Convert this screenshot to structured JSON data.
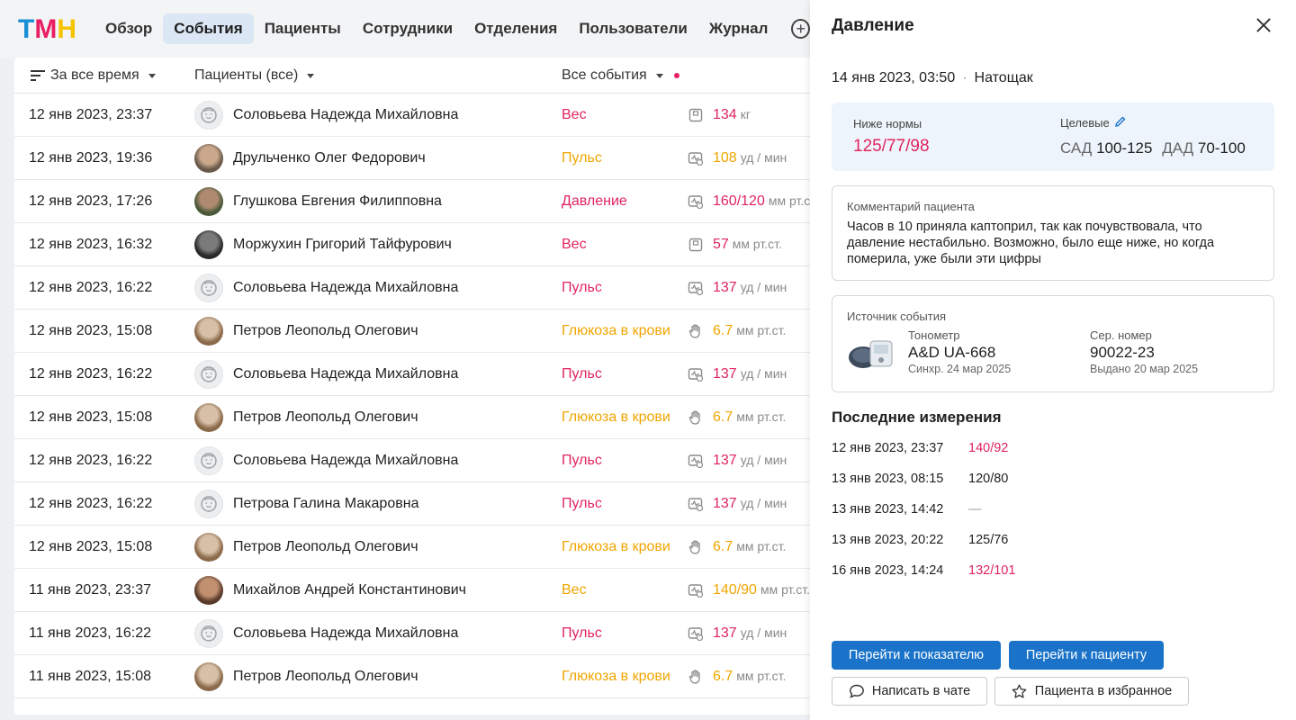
{
  "nav": {
    "logo": {
      "t": "Т",
      "m": "М",
      "n": "Н"
    },
    "items": [
      "Обзор",
      "События",
      "Пациенты",
      "Сотрудники",
      "Отделения",
      "Пользователи",
      "Журнал"
    ],
    "active": "События"
  },
  "list": {
    "filters": {
      "period": "За все время",
      "patients": "Пациенты (все)",
      "events": "Все события"
    },
    "rows": [
      {
        "date": "12 янв 2023, 23:37",
        "name": "Соловьева Надежда Михайловна",
        "event": "Вес",
        "value": "134",
        "unit": "кг",
        "avatar": "empty",
        "color": "pink",
        "icon": "scale"
      },
      {
        "date": "12 янв 2023, 19:36",
        "name": "Друльченко Олег Федорович",
        "event": "Пульс",
        "value": "108",
        "unit": "уд / мин",
        "avatar": "photo1",
        "color": "orange",
        "icon": "monitor"
      },
      {
        "date": "12 янв 2023, 17:26",
        "name": "Глушкова Евгения Филипповна",
        "event": "Давление",
        "value": "160/120",
        "unit": "мм рт.ст.",
        "avatar": "photo2",
        "color": "pink",
        "icon": "monitor"
      },
      {
        "date": "12 янв 2023, 16:32",
        "name": "Моржухин Григорий Тайфурович",
        "event": "Вес",
        "value": "57",
        "unit": "мм рт.ст.",
        "avatar": "photo3",
        "color": "pink",
        "icon": "scale"
      },
      {
        "date": "12 янв 2023, 16:22",
        "name": "Соловьева Надежда Михайловна",
        "event": "Пульс",
        "value": "137",
        "unit": "уд / мин",
        "avatar": "empty",
        "color": "pink",
        "icon": "monitor"
      },
      {
        "date": "12 янв 2023, 15:08",
        "name": "Петров Леопольд Олегович",
        "event": "Глюкоза в крови",
        "value": "6.7",
        "unit": "мм рт.ст.",
        "avatar": "photo4",
        "color": "orange",
        "icon": "hand"
      },
      {
        "date": "12 янв 2023, 16:22",
        "name": "Соловьева Надежда Михайловна",
        "event": "Пульс",
        "value": "137",
        "unit": "уд / мин",
        "avatar": "empty",
        "color": "pink",
        "icon": "monitor"
      },
      {
        "date": "12 янв 2023, 15:08",
        "name": "Петров Леопольд Олегович",
        "event": "Глюкоза в крови",
        "value": "6.7",
        "unit": "мм рт.ст.",
        "avatar": "photo4",
        "color": "orange",
        "icon": "hand"
      },
      {
        "date": "12 янв 2023, 16:22",
        "name": "Соловьева Надежда Михайловна",
        "event": "Пульс",
        "value": "137",
        "unit": "уд / мин",
        "avatar": "empty",
        "color": "pink",
        "icon": "monitor"
      },
      {
        "date": "12 янв 2023, 16:22",
        "name": "Петрова Галина Макаровна",
        "event": "Пульс",
        "value": "137",
        "unit": "уд / мин",
        "avatar": "empty",
        "color": "pink",
        "icon": "monitor"
      },
      {
        "date": "12 янв 2023, 15:08",
        "name": "Петров Леопольд Олегович",
        "event": "Глюкоза в крови",
        "value": "6.7",
        "unit": "мм рт.ст.",
        "avatar": "photo4",
        "color": "orange",
        "icon": "hand"
      },
      {
        "date": "11 янв 2023, 23:37",
        "name": "Михайлов Андрей Константинович",
        "event": "Вес",
        "value": "140/90",
        "unit": "мм рт.ст.",
        "avatar": "photo5",
        "color": "orange",
        "icon": "monitor"
      },
      {
        "date": "11 янв 2023, 16:22",
        "name": "Соловьева Надежда Михайловна",
        "event": "Пульс",
        "value": "137",
        "unit": "уд / мин",
        "avatar": "empty",
        "color": "pink",
        "icon": "monitor"
      },
      {
        "date": "11 янв 2023, 15:08",
        "name": "Петров Леопольд Олегович",
        "event": "Глюкоза в крови",
        "value": "6.7",
        "unit": "мм рт.ст.",
        "avatar": "photo4",
        "color": "orange",
        "icon": "hand"
      }
    ]
  },
  "drawer": {
    "title": "Давление",
    "datetime": "14 янв 2023, 03:50",
    "condition": "Натощак",
    "status_label": "Ниже нормы",
    "measured_value": "125/77/98",
    "target_label": "Целевые",
    "sad_label": "САД",
    "sad_value": "100-125",
    "dad_label": "ДАД",
    "dad_value": "70-100",
    "comment_label": "Комментарий пациента",
    "comment": "Часов в 10 приняла каптоприл, так как почувствовала, что давление нестабильно. Возможно, было еще ниже, но когда померила, уже были эти цифры",
    "source_label": "Источник события",
    "device_type_label": "Тонометр",
    "device_model": "A&D UA-668",
    "device_sync": "Синхр. 24 мар 2025",
    "serial_label": "Сер. номер",
    "serial_value": "90022-23",
    "issued": "Выдано 20 мар 2025",
    "recent_title": "Последние измерения",
    "recent": [
      {
        "date": "12 янв 2023, 23:37",
        "value": "140/92",
        "color": "pink"
      },
      {
        "date": "13 янв 2023, 08:15",
        "value": "120/80",
        "color": "normal"
      },
      {
        "date": "13 янв 2023, 14:42",
        "value": "—",
        "color": "muted"
      },
      {
        "date": "13 янв 2023, 20:22",
        "value": "125/76",
        "color": "normal"
      },
      {
        "date": "16 янв 2023, 14:24",
        "value": "132/101",
        "color": "pink"
      }
    ],
    "btn_indicator": "Перейти к показателю",
    "btn_patient": "Перейти к пациенту",
    "btn_chat": "Написать в чате",
    "btn_favorite": "Пациента в избранное"
  },
  "colors": {
    "pink": "#e0245e",
    "orange": "#f0a500",
    "primary": "#1a73c9",
    "active_tab": "#dbe7f4"
  }
}
